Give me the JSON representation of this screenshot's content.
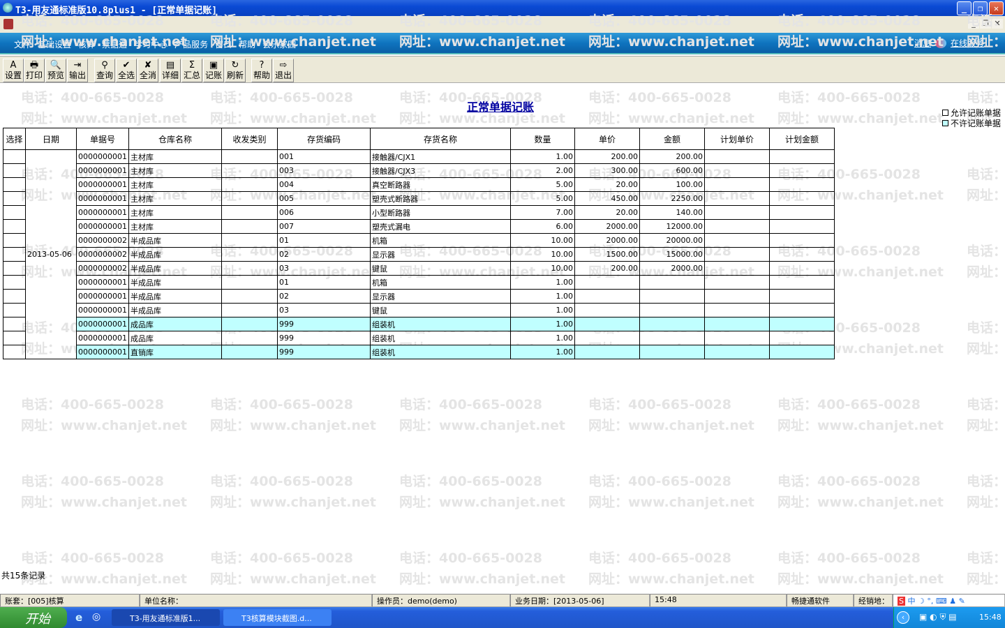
{
  "window": {
    "title": "T3-用友通标准版10.8plus1 - [正常单据记账]",
    "minimize": "_",
    "restore": "❐",
    "close": "✕"
  },
  "mdi": {
    "minimize": "_",
    "restore": "❐",
    "close": "✕"
  },
  "menu": {
    "items": [
      "文件",
      "基础设置",
      "核算",
      "票据通",
      "学习中心",
      "产品服务",
      "窗口",
      "帮助",
      "会乐家园"
    ],
    "message": "消息",
    "online_service": "在线服务"
  },
  "toolbar": [
    {
      "icon": "settings-icon",
      "glyph": "A",
      "label": "设置"
    },
    {
      "icon": "print-icon",
      "glyph": "🖶",
      "label": "打印"
    },
    {
      "icon": "preview-icon",
      "glyph": "🔍",
      "label": "预览"
    },
    {
      "icon": "export-icon",
      "glyph": "⇥",
      "label": "输出"
    },
    {
      "icon": "query-icon",
      "glyph": "⚲",
      "label": "查询"
    },
    {
      "icon": "select-all-icon",
      "glyph": "✔",
      "label": "全选"
    },
    {
      "icon": "deselect-all-icon",
      "glyph": "✘",
      "label": "全消"
    },
    {
      "icon": "detail-icon",
      "glyph": "▤",
      "label": "详细"
    },
    {
      "icon": "summary-icon",
      "glyph": "Σ",
      "label": "汇总"
    },
    {
      "icon": "post-icon",
      "glyph": "▣",
      "label": "记账"
    },
    {
      "icon": "refresh-icon",
      "glyph": "↻",
      "label": "刷新"
    },
    {
      "icon": "help-icon",
      "glyph": "?",
      "label": "帮助"
    },
    {
      "icon": "exit-icon",
      "glyph": "⇨",
      "label": "退出"
    }
  ],
  "watermark": {
    "phone": "电话：400-665-0028",
    "site": "网址：www.chanjet.net"
  },
  "page": {
    "title": "正常单据记账",
    "legend_allow": "允许记账单据",
    "legend_disallow": "不许记账单据",
    "count": "共15条记录"
  },
  "colors": {
    "allowed_row": "#ffffff",
    "disallowed_row": "#c0ffff"
  },
  "table": {
    "columns": [
      "选择",
      "日期",
      "单据号",
      "仓库名称",
      "收发类别",
      "存货编码",
      "存货名称",
      "数量",
      "单价",
      "金额",
      "计划单价",
      "计划金额"
    ],
    "date": "2013-05-06",
    "rows": [
      {
        "no": "0000000001",
        "wh": "主材库",
        "type": "",
        "code": "001",
        "name": "接触器/CJX1",
        "qty": "1.00",
        "price": "200.00",
        "amt": "200.00",
        "pp": "",
        "pa": "",
        "hl": false
      },
      {
        "no": "0000000001",
        "wh": "主材库",
        "type": "",
        "code": "003",
        "name": "接触器/CJX3",
        "qty": "2.00",
        "price": "300.00",
        "amt": "600.00",
        "pp": "",
        "pa": "",
        "hl": false
      },
      {
        "no": "0000000001",
        "wh": "主材库",
        "type": "",
        "code": "004",
        "name": "真空断路器",
        "qty": "5.00",
        "price": "20.00",
        "amt": "100.00",
        "pp": "",
        "pa": "",
        "hl": false
      },
      {
        "no": "0000000001",
        "wh": "主材库",
        "type": "",
        "code": "005",
        "name": "塑壳式断路器",
        "qty": "5.00",
        "price": "450.00",
        "amt": "2250.00",
        "pp": "",
        "pa": "",
        "hl": false
      },
      {
        "no": "0000000001",
        "wh": "主材库",
        "type": "",
        "code": "006",
        "name": "小型断路器",
        "qty": "7.00",
        "price": "20.00",
        "amt": "140.00",
        "pp": "",
        "pa": "",
        "hl": false
      },
      {
        "no": "0000000001",
        "wh": "主材库",
        "type": "",
        "code": "007",
        "name": "塑壳式漏电",
        "qty": "6.00",
        "price": "2000.00",
        "amt": "12000.00",
        "pp": "",
        "pa": "",
        "hl": false
      },
      {
        "no": "0000000002",
        "wh": "半成品库",
        "type": "",
        "code": "01",
        "name": "机箱",
        "qty": "10.00",
        "price": "2000.00",
        "amt": "20000.00",
        "pp": "",
        "pa": "",
        "hl": false
      },
      {
        "no": "0000000002",
        "wh": "半成品库",
        "type": "",
        "code": "02",
        "name": "显示器",
        "qty": "10.00",
        "price": "1500.00",
        "amt": "15000.00",
        "pp": "",
        "pa": "",
        "hl": false
      },
      {
        "no": "0000000002",
        "wh": "半成品库",
        "type": "",
        "code": "03",
        "name": "键鼠",
        "qty": "10.00",
        "price": "200.00",
        "amt": "2000.00",
        "pp": "",
        "pa": "",
        "hl": false
      },
      {
        "no": "0000000001",
        "wh": "半成品库",
        "type": "",
        "code": "01",
        "name": "机箱",
        "qty": "1.00",
        "price": "",
        "amt": "",
        "pp": "",
        "pa": "",
        "hl": false
      },
      {
        "no": "0000000001",
        "wh": "半成品库",
        "type": "",
        "code": "02",
        "name": "显示器",
        "qty": "1.00",
        "price": "",
        "amt": "",
        "pp": "",
        "pa": "",
        "hl": false
      },
      {
        "no": "0000000001",
        "wh": "半成品库",
        "type": "",
        "code": "03",
        "name": "键鼠",
        "qty": "1.00",
        "price": "",
        "amt": "",
        "pp": "",
        "pa": "",
        "hl": false
      },
      {
        "no": "0000000001",
        "wh": "成品库",
        "type": "",
        "code": "999",
        "name": "组装机",
        "qty": "1.00",
        "price": "",
        "amt": "",
        "pp": "",
        "pa": "",
        "hl": true
      },
      {
        "no": "0000000001",
        "wh": "成品库",
        "type": "",
        "code": "999",
        "name": "组装机",
        "qty": "1.00",
        "price": "",
        "amt": "",
        "pp": "",
        "pa": "",
        "hl": false
      },
      {
        "no": "0000000001",
        "wh": "直销库",
        "type": "",
        "code": "999",
        "name": "组装机",
        "qty": "1.00",
        "price": "",
        "amt": "",
        "pp": "",
        "pa": "",
        "hl": true
      }
    ]
  },
  "status": {
    "account": "账套：[005]核算",
    "unit": "单位名称：",
    "operator": "操作员：demo(demo)",
    "biz_date": "业务日期：[2013-05-06]",
    "time": "15:48",
    "vendor": "畅捷通软件",
    "dealer": "经销地："
  },
  "taskbar": {
    "start": "开始",
    "tasks": [
      "T3-用友通标准版1...",
      "T3核算模块截图.d..."
    ],
    "clock": "15:48",
    "ime": "中"
  }
}
